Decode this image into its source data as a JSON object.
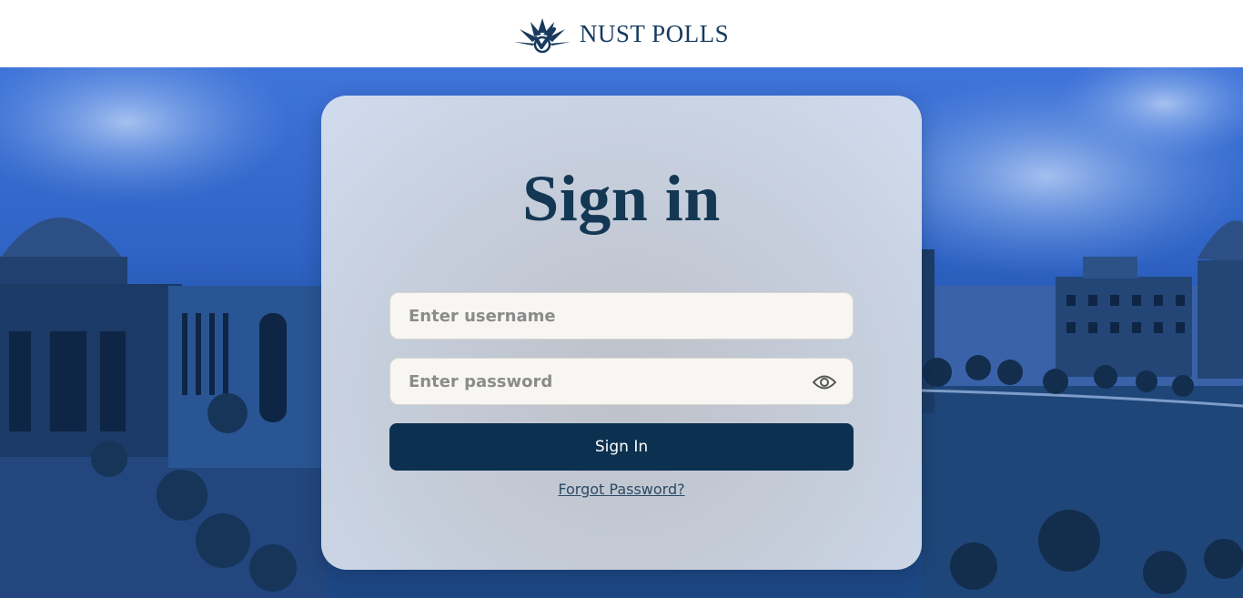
{
  "header": {
    "logo_icon": "ballot-check-logo-icon",
    "brand_name": "NUST POLLS"
  },
  "signin": {
    "title": "Sign in",
    "username_placeholder": "Enter username",
    "password_placeholder": "Enter password",
    "toggle_visibility_icon": "eye-icon",
    "submit_label": "Sign In",
    "forgot_password_label": "Forgot Password?"
  },
  "colors": {
    "brand_navy": "#0c3150",
    "title": "#143754",
    "hero_blue": "#2f63c4"
  }
}
